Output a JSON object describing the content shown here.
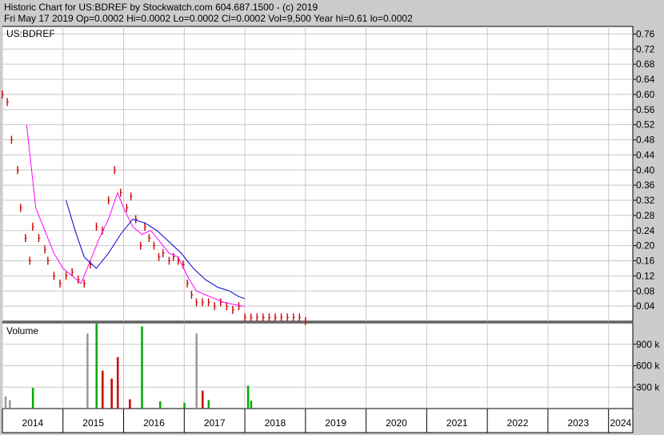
{
  "header": {
    "line1": "Historic Chart for US:BDREF by Stockwatch.com 604.687.1500 - (c) 2019",
    "line2": "Fri May 17 2019  Op=0.0002  Hi=0.0002  Lo=0.0002  Cl=0.0002  Vol=9,500  Year hi=0.61  lo=0.0002"
  },
  "colors": {
    "background": "#cccccc",
    "plot_bg": "#ffffff",
    "grid": "#c8c8c8",
    "price_bar": "#cc0000",
    "ma_short": "#ff00ff",
    "ma_long": "#0000cc",
    "vol_up": "#00aa00",
    "vol_down": "#cc0000",
    "vol_neutral": "#999999"
  },
  "chart_data": [
    {
      "type": "line",
      "title": "US:BDREF",
      "ylim": [
        0.0,
        0.78
      ],
      "y_ticks": [
        "0.76",
        "0.72",
        "0.68",
        "0.64",
        "0.60",
        "0.56",
        "0.52",
        "0.48",
        "0.44",
        "0.40",
        "0.36",
        "0.32",
        "0.28",
        "0.24",
        "0.20",
        "0.16",
        "0.12",
        "0.08",
        "0.04"
      ],
      "x_labels": [
        "2014",
        "2015",
        "2016",
        "2017",
        "2018",
        "2019",
        "2020",
        "2021",
        "2022",
        "2023",
        "2024"
      ],
      "xlim": [
        2014.0,
        2024.4
      ],
      "grid": true,
      "series": [
        {
          "style": "price_bars",
          "x": [
            2014.0,
            2014.08,
            2014.15,
            2014.25,
            2014.3,
            2014.38,
            2014.45,
            2014.5,
            2014.6,
            2014.7,
            2014.75,
            2014.85,
            2014.95,
            2015.05,
            2015.15,
            2015.25,
            2015.35,
            2015.45,
            2015.55,
            2015.65,
            2015.75,
            2015.85,
            2015.95,
            2016.05,
            2016.12,
            2016.2,
            2016.28,
            2016.35,
            2016.42,
            2016.5,
            2016.58,
            2016.65,
            2016.75,
            2016.82,
            2016.9,
            2016.98,
            2017.05,
            2017.12,
            2017.2,
            2017.3,
            2017.4,
            2017.5,
            2017.6,
            2017.7,
            2017.8,
            2017.9,
            2018.0,
            2018.1,
            2018.2,
            2018.3,
            2018.4,
            2018.5,
            2018.6,
            2018.7,
            2018.8,
            2018.9,
            2019.0
          ],
          "y": [
            0.6,
            0.58,
            0.48,
            0.4,
            0.3,
            0.22,
            0.16,
            0.25,
            0.22,
            0.19,
            0.16,
            0.12,
            0.1,
            0.12,
            0.13,
            0.11,
            0.1,
            0.15,
            0.25,
            0.24,
            0.32,
            0.4,
            0.34,
            0.3,
            0.33,
            0.27,
            0.2,
            0.25,
            0.22,
            0.2,
            0.17,
            0.18,
            0.16,
            0.17,
            0.16,
            0.15,
            0.1,
            0.07,
            0.05,
            0.05,
            0.05,
            0.04,
            0.05,
            0.04,
            0.03,
            0.04,
            0.01,
            0.01,
            0.01,
            0.01,
            0.01,
            0.01,
            0.01,
            0.01,
            0.01,
            0.01,
            0.0002
          ]
        },
        {
          "style": "ma_short",
          "x": [
            2014.4,
            2014.55,
            2014.7,
            2014.85,
            2015.0,
            2015.15,
            2015.3,
            2015.45,
            2015.6,
            2015.75,
            2015.9,
            2016.0,
            2016.15,
            2016.3,
            2016.45,
            2016.6,
            2016.75,
            2016.9,
            2017.05,
            2017.2,
            2017.35,
            2017.5,
            2017.65,
            2017.8,
            2017.95,
            2018.0
          ],
          "y": [
            0.52,
            0.3,
            0.24,
            0.18,
            0.14,
            0.12,
            0.1,
            0.16,
            0.22,
            0.27,
            0.34,
            0.3,
            0.25,
            0.23,
            0.24,
            0.21,
            0.18,
            0.17,
            0.12,
            0.08,
            0.07,
            0.06,
            0.05,
            0.045,
            0.04,
            0.04
          ]
        },
        {
          "style": "ma_long",
          "x": [
            2015.05,
            2015.2,
            2015.35,
            2015.55,
            2015.75,
            2015.95,
            2016.15,
            2016.35,
            2016.55,
            2016.75,
            2016.95,
            2017.15,
            2017.35,
            2017.55,
            2017.75,
            2017.9,
            2018.0
          ],
          "y": [
            0.32,
            0.24,
            0.17,
            0.14,
            0.18,
            0.23,
            0.27,
            0.26,
            0.24,
            0.21,
            0.18,
            0.14,
            0.11,
            0.09,
            0.08,
            0.065,
            0.06
          ]
        }
      ]
    },
    {
      "type": "bar",
      "title": "Volume",
      "ylim": [
        0,
        1200
      ],
      "y_ticks": [
        "900 k",
        "600 k",
        "300 k"
      ],
      "bars": [
        {
          "x": 2014.05,
          "v": 170,
          "c": "neutral"
        },
        {
          "x": 2014.12,
          "v": 120,
          "c": "neutral"
        },
        {
          "x": 2014.5,
          "v": 290,
          "c": "up"
        },
        {
          "x": 2015.4,
          "v": 1050,
          "c": "neutral"
        },
        {
          "x": 2015.55,
          "v": 1190,
          "c": "up"
        },
        {
          "x": 2015.65,
          "v": 530,
          "c": "down"
        },
        {
          "x": 2015.8,
          "v": 420,
          "c": "down"
        },
        {
          "x": 2015.9,
          "v": 720,
          "c": "down"
        },
        {
          "x": 2016.3,
          "v": 1150,
          "c": "up"
        },
        {
          "x": 2016.1,
          "v": 130,
          "c": "down"
        },
        {
          "x": 2016.6,
          "v": 100,
          "c": "up"
        },
        {
          "x": 2017.0,
          "v": 80,
          "c": "up"
        },
        {
          "x": 2017.2,
          "v": 1050,
          "c": "neutral"
        },
        {
          "x": 2017.3,
          "v": 250,
          "c": "down"
        },
        {
          "x": 2017.4,
          "v": 120,
          "c": "up"
        },
        {
          "x": 2018.05,
          "v": 320,
          "c": "up"
        },
        {
          "x": 2018.1,
          "v": 110,
          "c": "up"
        }
      ]
    }
  ]
}
